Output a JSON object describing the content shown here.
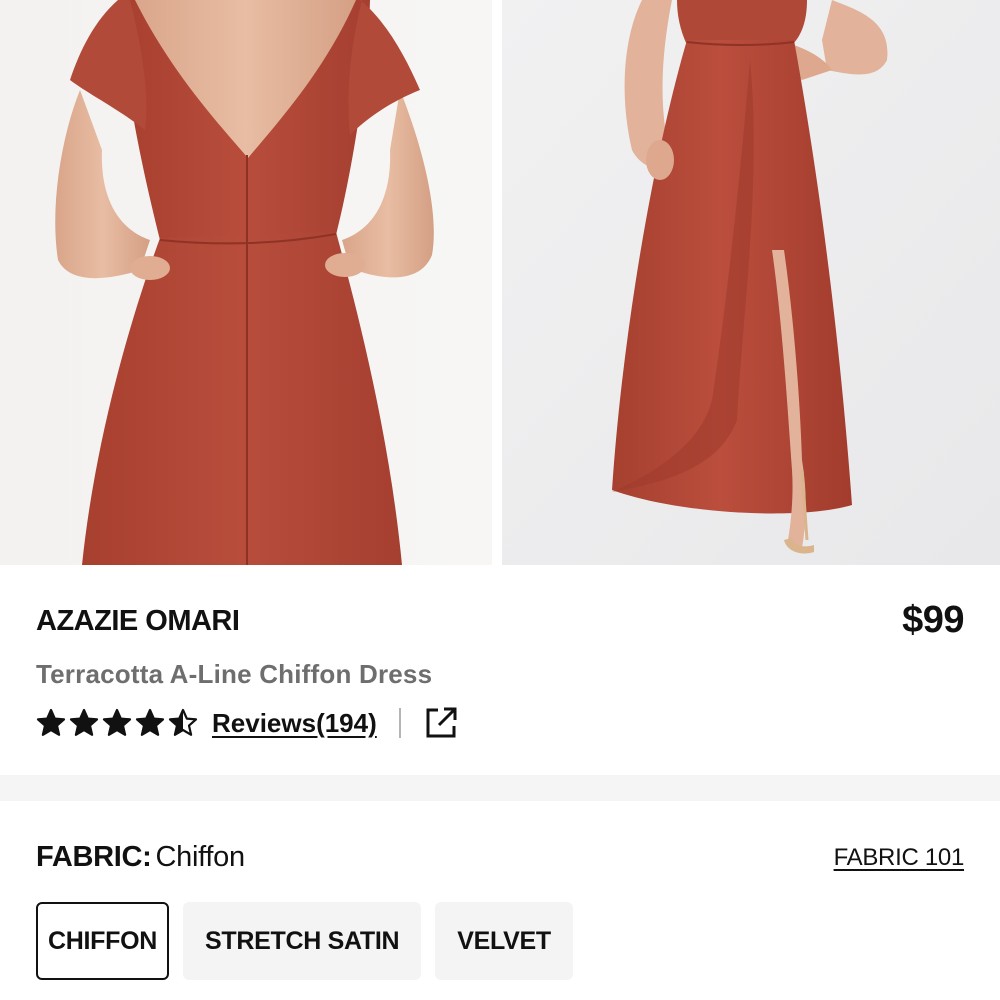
{
  "gallery": {
    "images": [
      {
        "name": "dress-back-view"
      },
      {
        "name": "dress-front-view"
      }
    ],
    "dress_color": "#b0493a"
  },
  "product": {
    "brand": "AZAZIE OMARI",
    "price": "$99",
    "name": "Terracotta A-Line Chiffon Dress",
    "rating": 4.5,
    "rating_max": 5,
    "reviews_label": "Reviews(194)",
    "share_icon": "external-link-icon"
  },
  "fabric": {
    "label": "FABRIC:",
    "selected_value": "Chiffon",
    "guide_link": "FABRIC 101",
    "options": [
      {
        "label": "CHIFFON",
        "selected": true
      },
      {
        "label": "STRETCH SATIN",
        "selected": false
      },
      {
        "label": "VELVET",
        "selected": false
      }
    ]
  },
  "colors": {
    "text": "#111111",
    "muted": "#6e6e6e",
    "option_bg": "#f4f4f4",
    "separator": "#f5f5f5"
  }
}
